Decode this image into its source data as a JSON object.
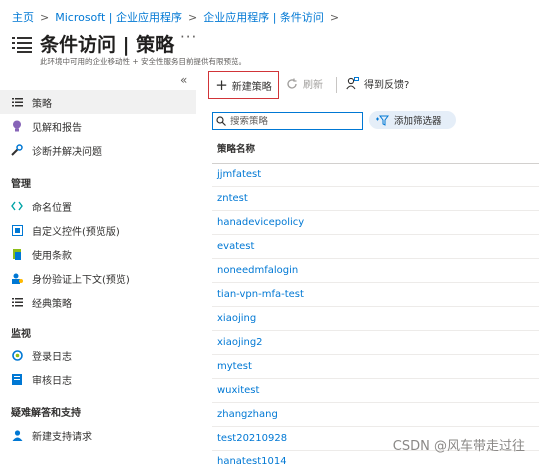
{
  "breadcrumb": [
    "主页",
    "Microsoft | 企业应用程序",
    "企业应用程序 | 条件访问"
  ],
  "breadcrumb_separator": ">",
  "page": {
    "title": "条件访问 | 策略",
    "more": "···",
    "subtitle": "此环境中可用的企业移动性 + 安全性服务目前提供有限预览。"
  },
  "sidebar": {
    "collapse_glyph": "«",
    "top_items": [
      {
        "label": "策略",
        "icon": "list-icon",
        "active": true
      },
      {
        "label": "见解和报告",
        "icon": "lightbulb-icon"
      },
      {
        "label": "诊断并解决问题",
        "icon": "wrench-icon"
      }
    ],
    "sections": [
      {
        "heading": "管理",
        "items": [
          {
            "label": "命名位置",
            "icon": "location-arrows-icon"
          },
          {
            "label": "自定义控件(预览版)",
            "icon": "custom-control-icon"
          },
          {
            "label": "使用条款",
            "icon": "terms-icon"
          },
          {
            "label": "身份验证上下文(预览)",
            "icon": "auth-context-icon"
          },
          {
            "label": "经典策略",
            "icon": "list-icon"
          }
        ]
      },
      {
        "heading": "监视",
        "items": [
          {
            "label": "登录日志",
            "icon": "sign-in-log-icon"
          },
          {
            "label": "审核日志",
            "icon": "audit-log-icon"
          }
        ]
      },
      {
        "heading": "疑难解答和支持",
        "items": [
          {
            "label": "新建支持请求",
            "icon": "support-person-icon"
          }
        ]
      }
    ]
  },
  "toolbar": {
    "new_policy": "新建策略",
    "refresh": "刷新",
    "feedback": "得到反馈?"
  },
  "search": {
    "placeholder": "搜索策略"
  },
  "filter": {
    "label": "添加筛选器"
  },
  "table": {
    "column_header": "策略名称",
    "rows": [
      "jjmfatest",
      "zntest",
      "hanadevicepolicy",
      "evatest",
      "noneedmfalogin",
      "tian-vpn-mfa-test",
      "xiaojing",
      "xiaojing2",
      "mytest",
      "wuxitest",
      "zhangzhang",
      "test20210928",
      "hanatest1014"
    ]
  },
  "watermark": "CSDN @风车带走过往",
  "colors": {
    "accent": "#0078d4",
    "highlight_border": "#d13438",
    "nav_active_bg": "#f1f1f1"
  }
}
